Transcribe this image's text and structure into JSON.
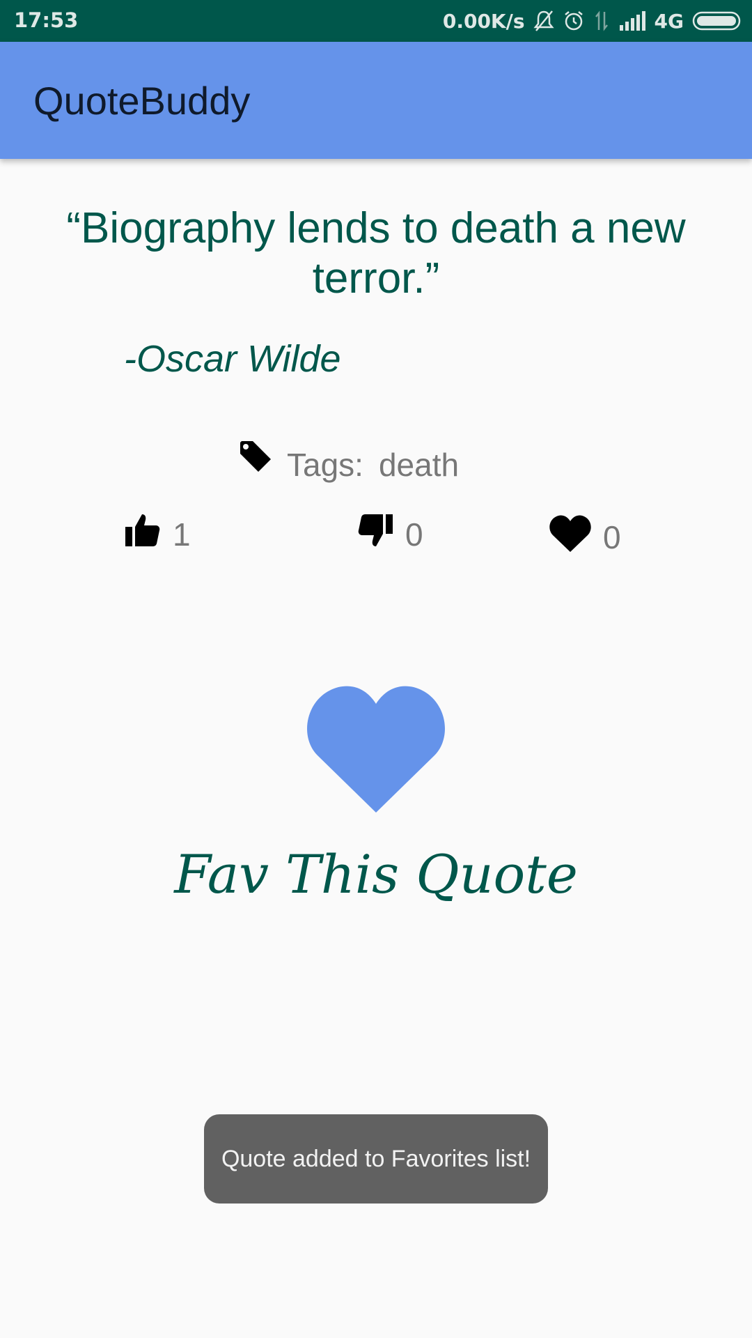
{
  "status_bar": {
    "time": "17:53",
    "net_speed": "0.00K/s",
    "network": "4G",
    "icons": [
      "mute-bell-icon",
      "alarm-icon",
      "data-arrows-icon",
      "signal-icon",
      "battery-icon"
    ]
  },
  "app_bar": {
    "title": "QuoteBuddy",
    "color": "#6593ea"
  },
  "quote": {
    "text": "“Biography lends to death a new terror.”",
    "author": "-Oscar Wilde",
    "text_color": "#00574b"
  },
  "tags": {
    "label": "Tags:",
    "value": "death",
    "icon": "tag-icon"
  },
  "stats": {
    "likes": "1",
    "dislikes": "0",
    "favorites": "0"
  },
  "fav_action": {
    "label": "Fav This Quote",
    "icon": "heart-icon",
    "color": "#6593ea"
  },
  "toast": {
    "message": "Quote added to Favorites list!"
  }
}
